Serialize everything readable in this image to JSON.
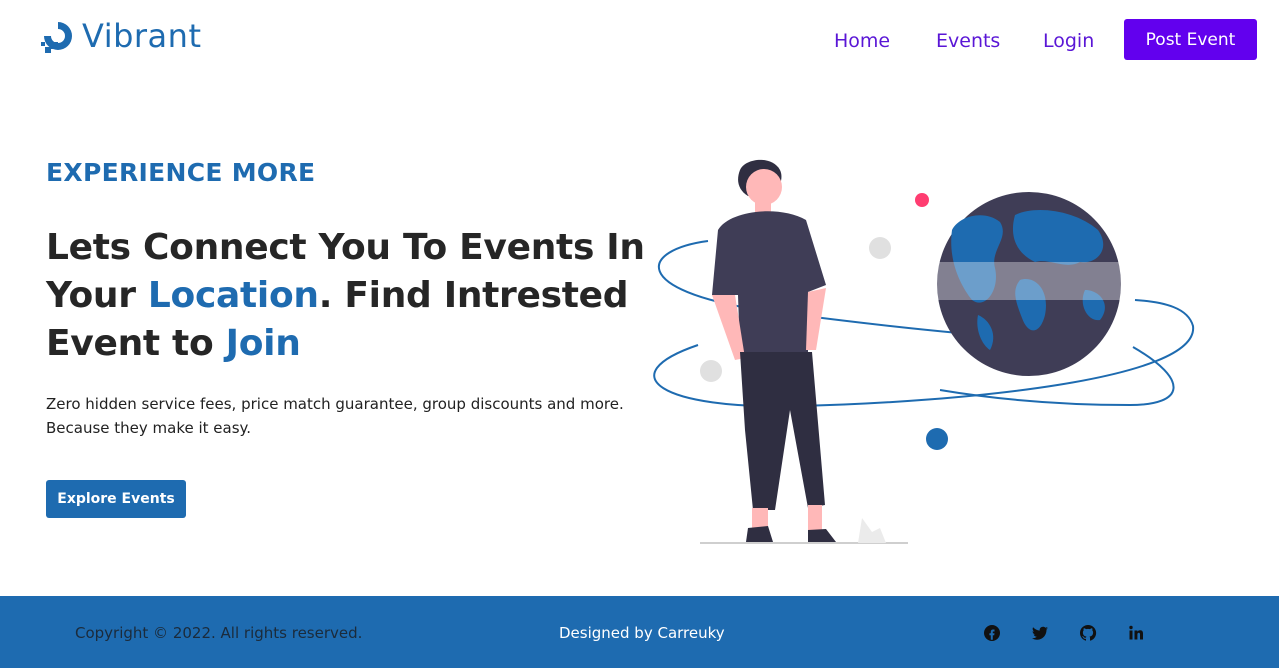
{
  "nav": {
    "brand": "Vibrant",
    "links": [
      "Home",
      "Events",
      "Login"
    ],
    "cta": "Post Event"
  },
  "hero": {
    "eyebrow": "EXPERIENCE MORE",
    "headline": {
      "part1": "Lets Connect You To Events In Your ",
      "accent1": "Location",
      "part2": ". Find Intrested Event to ",
      "accent2": "Join"
    },
    "description": "Zero hidden service fees, price match guarantee, group discounts and more. Because they make it easy.",
    "button": "Explore Events"
  },
  "footer": {
    "copyright": "Copyright © 2022. All rights reserved.",
    "designed_by": "Designed by Carreuky",
    "social": [
      "facebook-icon",
      "twitter-icon",
      "github-icon",
      "linkedin-icon"
    ]
  },
  "colors": {
    "brand": "#1e6bb0",
    "nav_link": "#5a16d6",
    "cta": "#6200ee",
    "footer_bg": "#1e6bb0",
    "globe": "#3f3d56"
  }
}
